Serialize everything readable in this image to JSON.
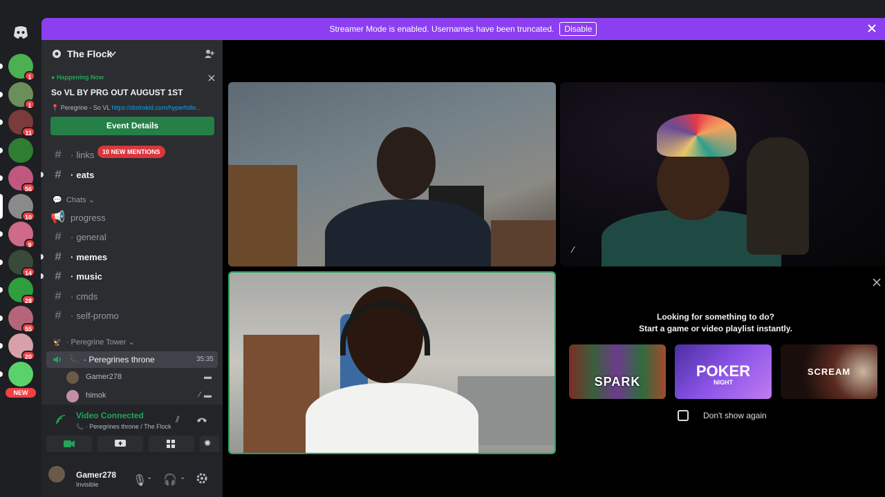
{
  "banner": {
    "text": "Streamer Mode is enabled. Usernames have been truncated.",
    "disable_label": "Disable"
  },
  "servers": [
    {
      "badge": "1"
    },
    {
      "badge": "1"
    },
    {
      "badge": "11"
    },
    {
      "badge": ""
    },
    {
      "badge": "56"
    },
    {
      "badge": "10"
    },
    {
      "badge": "9"
    },
    {
      "badge": "14"
    },
    {
      "badge": "28"
    },
    {
      "badge": "55"
    },
    {
      "badge": "20"
    },
    {
      "badge": ""
    }
  ],
  "new_label": "NEW",
  "server": {
    "name": "The Flock"
  },
  "event": {
    "status": "Happening Now",
    "title": "So VL BY PRG OUT AUGUST 1ST",
    "location_prefix": "Peregrine - So VL",
    "location_link": "https://distrokid.com/hyperfollo...",
    "button_label": "Event Details"
  },
  "channels": {
    "links": "links",
    "mentions": "10 NEW MENTIONS",
    "eats": "eats",
    "category_chats": "Chats",
    "progress": "progress",
    "general": "general",
    "memes": "memes",
    "music": "music",
    "cmds": "cmds",
    "self_promo": "self-promo",
    "category_tower": "Peregrine Tower",
    "voice_channel": "Peregrines throne",
    "voice_time": "35:35",
    "voice_users": [
      "Gamer278",
      "himok"
    ]
  },
  "voice_panel": {
    "status": "Video Connected",
    "location": "Peregrines throne / The Flock"
  },
  "user": {
    "name": "Gamer278",
    "status": "Invisible"
  },
  "promo": {
    "line1": "Looking for something to do?",
    "line2": "Start a game or video playlist instantly.",
    "cards": [
      "SPARK",
      "POKER",
      "SCREAM"
    ],
    "poker_sub": "NIGHT",
    "checkbox_label": "Don't show again"
  },
  "colors": {
    "accent": "#8c3ff0",
    "connected": "#23a55a",
    "mention": "#da373c",
    "link": "#00a8fc"
  }
}
